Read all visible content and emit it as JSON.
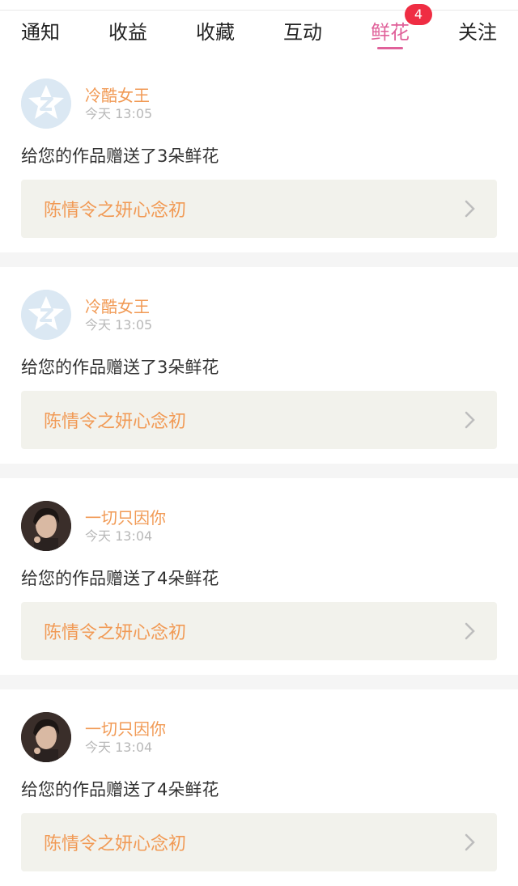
{
  "tabs": [
    {
      "label": "通知",
      "active": false
    },
    {
      "label": "收益",
      "active": false
    },
    {
      "label": "收藏",
      "active": false
    },
    {
      "label": "互动",
      "active": false
    },
    {
      "label": "鲜花",
      "active": true,
      "badge": "4"
    },
    {
      "label": "关注",
      "active": false
    }
  ],
  "colors": {
    "accent": "#e0619a",
    "badge": "#ef2d43",
    "nickname": "#f19a55"
  },
  "notifications": [
    {
      "avatar": "default-avatar-icon",
      "nickname": "冷酷女王",
      "time": "今天 13:05",
      "message": "给您的作品赠送了3朵鲜花",
      "work_title": "陈情令之妍心念初"
    },
    {
      "avatar": "default-avatar-icon",
      "nickname": "冷酷女王",
      "time": "今天 13:05",
      "message": "给您的作品赠送了3朵鲜花",
      "work_title": "陈情令之妍心念初"
    },
    {
      "avatar": "user-photo-avatar",
      "nickname": "一切只因你",
      "time": "今天 13:04",
      "message": "给您的作品赠送了4朵鲜花",
      "work_title": "陈情令之妍心念初"
    },
    {
      "avatar": "user-photo-avatar",
      "nickname": "一切只因你",
      "time": "今天 13:04",
      "message": "给您的作品赠送了4朵鲜花",
      "work_title": "陈情令之妍心念初"
    }
  ]
}
